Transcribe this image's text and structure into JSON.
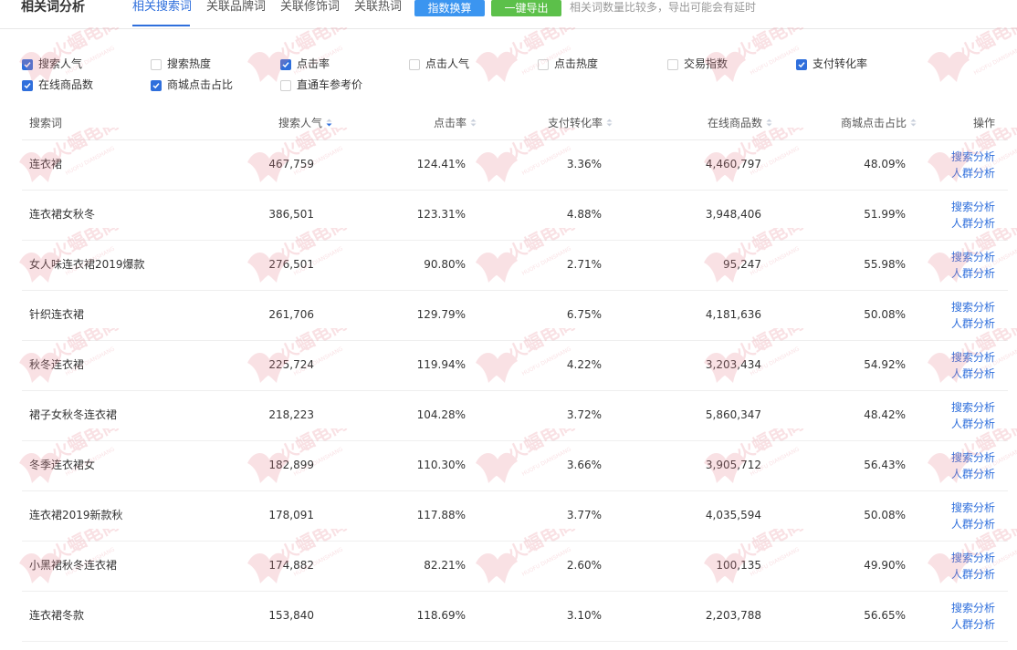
{
  "header": {
    "title": "相关词分析",
    "tabs": [
      {
        "label": "相关搜索词",
        "active": true
      },
      {
        "label": "关联品牌词",
        "active": false
      },
      {
        "label": "关联修饰词",
        "active": false
      },
      {
        "label": "关联热词",
        "active": false
      }
    ],
    "index_convert_button": "指数换算",
    "export_button": "一键导出",
    "hint": "相关词数量比较多，导出可能会有延时"
  },
  "filters": [
    {
      "label": "搜索人气",
      "checked": true
    },
    {
      "label": "搜索热度",
      "checked": false
    },
    {
      "label": "点击率",
      "checked": true
    },
    {
      "label": "点击人气",
      "checked": false
    },
    {
      "label": "点击热度",
      "checked": false
    },
    {
      "label": "交易指数",
      "checked": false
    },
    {
      "label": "支付转化率",
      "checked": true
    },
    {
      "label": "在线商品数",
      "checked": true
    },
    {
      "label": "商城点击占比",
      "checked": true
    },
    {
      "label": "直通车参考价",
      "checked": false
    }
  ],
  "table": {
    "columns": [
      "搜索词",
      "搜索人气",
      "点击率",
      "支付转化率",
      "在线商品数",
      "商城点击占比",
      "操作"
    ],
    "active_sort_column": "搜索人气",
    "rows": [
      {
        "keyword": "连衣裙",
        "search_popularity": "467,759",
        "ctr": "124.41%",
        "conversion": "3.36%",
        "online_items": "4,460,797",
        "mall_click_share": "48.09%"
      },
      {
        "keyword": "连衣裙女秋冬",
        "search_popularity": "386,501",
        "ctr": "123.31%",
        "conversion": "4.88%",
        "online_items": "3,948,406",
        "mall_click_share": "51.99%"
      },
      {
        "keyword": "女人味连衣裙2019爆款",
        "search_popularity": "276,501",
        "ctr": "90.80%",
        "conversion": "2.71%",
        "online_items": "95,247",
        "mall_click_share": "55.98%"
      },
      {
        "keyword": "针织连衣裙",
        "search_popularity": "261,706",
        "ctr": "129.79%",
        "conversion": "6.75%",
        "online_items": "4,181,636",
        "mall_click_share": "50.08%"
      },
      {
        "keyword": "秋冬连衣裙",
        "search_popularity": "225,724",
        "ctr": "119.94%",
        "conversion": "4.22%",
        "online_items": "3,203,434",
        "mall_click_share": "54.92%"
      },
      {
        "keyword": "裙子女秋冬连衣裙",
        "search_popularity": "218,223",
        "ctr": "104.28%",
        "conversion": "3.72%",
        "online_items": "5,860,347",
        "mall_click_share": "48.42%"
      },
      {
        "keyword": "冬季连衣裙女",
        "search_popularity": "182,899",
        "ctr": "110.30%",
        "conversion": "3.66%",
        "online_items": "3,905,712",
        "mall_click_share": "56.43%"
      },
      {
        "keyword": "连衣裙2019新款秋",
        "search_popularity": "178,091",
        "ctr": "117.88%",
        "conversion": "3.77%",
        "online_items": "4,035,594",
        "mall_click_share": "50.08%"
      },
      {
        "keyword": "小黑裙秋冬连衣裙",
        "search_popularity": "174,882",
        "ctr": "82.21%",
        "conversion": "2.60%",
        "online_items": "100,135",
        "mall_click_share": "49.90%"
      },
      {
        "keyword": "连衣裙冬款",
        "search_popularity": "153,840",
        "ctr": "118.69%",
        "conversion": "3.10%",
        "online_items": "2,203,788",
        "mall_click_share": "56.65%"
      }
    ],
    "actions": {
      "search_analysis": "搜索分析",
      "crowd_analysis": "人群分析"
    }
  },
  "watermark": {
    "brand": "火蝠电商",
    "sub": "HUOFU DIANSHANG",
    "color": "#e8818f"
  },
  "colors": {
    "accent": "#2f6fdc",
    "primary_button": "#3b95f0",
    "export_button": "#5cc04a"
  }
}
